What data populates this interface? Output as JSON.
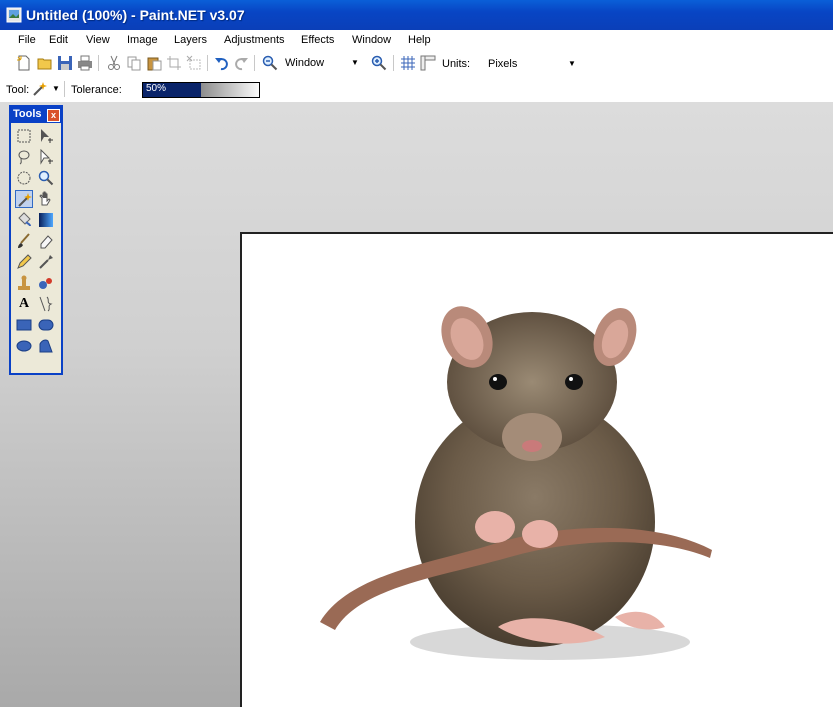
{
  "window": {
    "title": "Untitled (100%) - Paint.NET v3.07"
  },
  "menu": [
    "File",
    "Edit",
    "View",
    "Image",
    "Layers",
    "Adjustments",
    "Effects",
    "Window",
    "Help"
  ],
  "toolbar": {
    "zoom_value": "Window",
    "units_label": "Units:",
    "units_value": "Pixels"
  },
  "toolbar2": {
    "tool_label": "Tool:",
    "tolerance_label": "Tolerance:",
    "tolerance_value": "50%"
  },
  "tools_window": {
    "title": "Tools",
    "close": "x",
    "text_tool_glyph": "A"
  },
  "colors": {
    "titlebar": "#0845c4",
    "workspace": "#d0d0d0",
    "tools_border": "#0a41c6"
  }
}
